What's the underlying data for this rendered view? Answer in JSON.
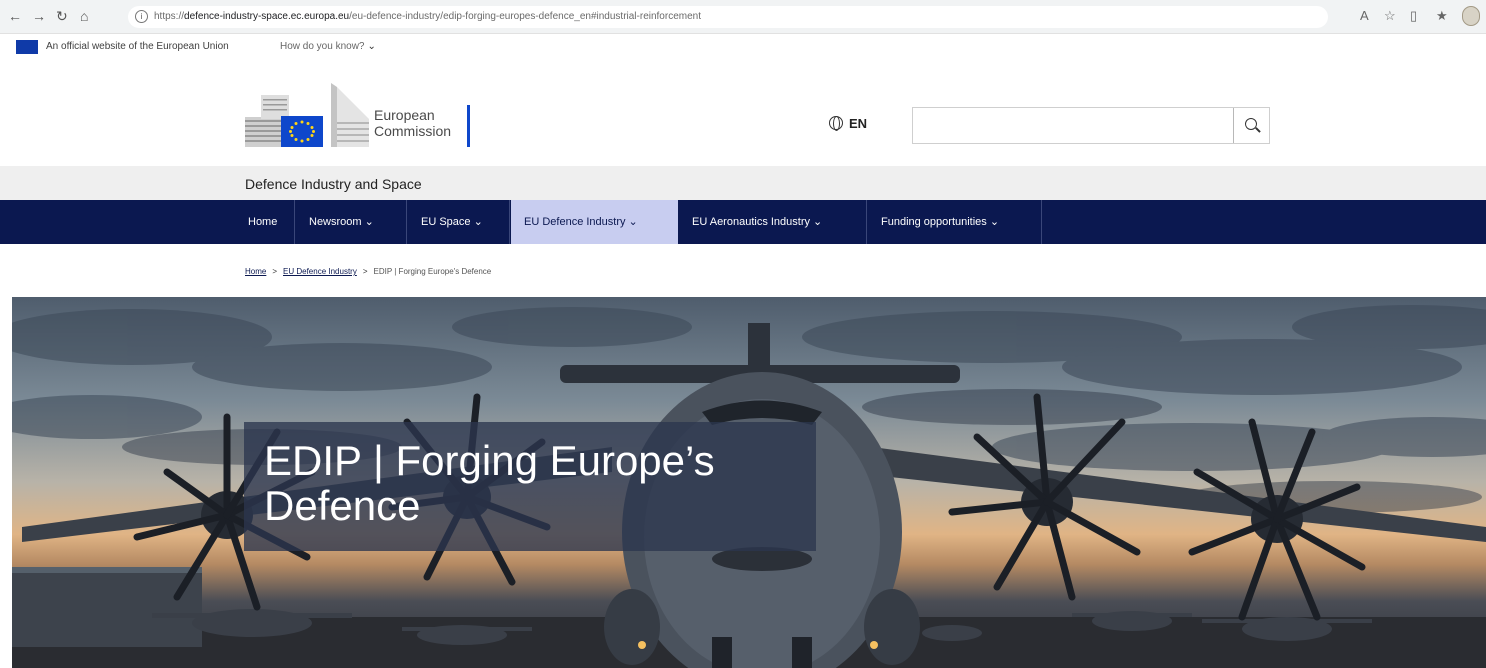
{
  "browser": {
    "url_prefix": "https://",
    "url_domain": "defence-industry-space.ec.europa.eu",
    "url_path": "/eu-defence-industry/edip-forging-europes-defence_en#industrial-reinforcement",
    "info_glyph": "i",
    "back_glyph": "←",
    "forward_glyph": "→",
    "reload_glyph": "↻",
    "home_glyph": "⌂",
    "toolbar_icons": [
      "read-aloud-icon",
      "favorite-star-icon",
      "split-screen-icon",
      "favorites-icon",
      "profile-icon"
    ],
    "icon_glyphs": [
      "A",
      "☆",
      "▯",
      "★"
    ]
  },
  "eu_banner": {
    "text": "An official website of the European Union",
    "how_know": "How do you know?",
    "chevron": "⌄"
  },
  "header": {
    "logo_line1": "European",
    "logo_line2": "Commission",
    "language": "EN",
    "search_placeholder": ""
  },
  "site_name": "Defence Industry and Space",
  "nav": {
    "items": [
      {
        "label": "Home"
      },
      {
        "label": "Newsroom ⌄"
      },
      {
        "label": "EU Space ⌄"
      },
      {
        "label": "EU Defence Industry ⌄",
        "active": true
      },
      {
        "label": "EU Aeronautics Industry ⌄"
      },
      {
        "label": "Funding opportunities ⌄"
      }
    ]
  },
  "breadcrumb": {
    "items": [
      "Home",
      "EU Defence Industry"
    ],
    "current": "EDIP | Forging Europe's Defence",
    "separator": ">"
  },
  "hero": {
    "title": "EDIP | Forging Europe’s Defence"
  },
  "colors": {
    "nav_bg": "#0b1850",
    "nav_active_bg": "#c8cdf0",
    "site_name_bar": "#efefef",
    "eu_blue": "#0e47cb"
  }
}
